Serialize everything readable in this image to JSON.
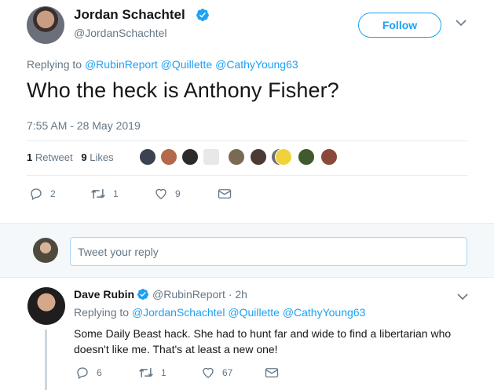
{
  "main_tweet": {
    "author_name": "Jordan Schachtel",
    "author_handle": "@JordanSchachtel",
    "follow_label": "Follow",
    "replying_prefix": "Replying to",
    "replying_mentions": [
      "@RubinReport",
      "@Quillette",
      "@CathyYoung63"
    ],
    "text": "Who the heck is Anthony Fisher?",
    "timestamp": "7:55 AM - 28 May 2019",
    "retweet_count": "1",
    "retweet_label": "Retweet",
    "like_count": "9",
    "like_label": "Likes",
    "actions": {
      "reply_count": "2",
      "retweet_count": "1",
      "like_count": "9"
    }
  },
  "reply_box": {
    "placeholder": "Tweet your reply"
  },
  "reply_tweet": {
    "author_name": "Dave Rubin",
    "author_handle": "@RubinReport",
    "time": "· 2h",
    "replying_prefix": "Replying to",
    "replying_mentions": [
      "@JordanSchachtel",
      "@Quillette",
      "@CathyYoung63"
    ],
    "text": "Some Daily Beast hack. She had to hunt far and wide to find a libertarian who doesn't like me. That's at least a new one!",
    "actions": {
      "reply_count": "6",
      "retweet_count": "1",
      "like_count": "67"
    }
  },
  "colors": {
    "accent": "#1da1f2",
    "secondary_text": "#657786",
    "divider": "#e6ecf0"
  },
  "icons": [
    "verified-badge-icon",
    "chevron-down-icon",
    "reply-icon",
    "retweet-icon",
    "like-icon",
    "direct-message-icon"
  ]
}
